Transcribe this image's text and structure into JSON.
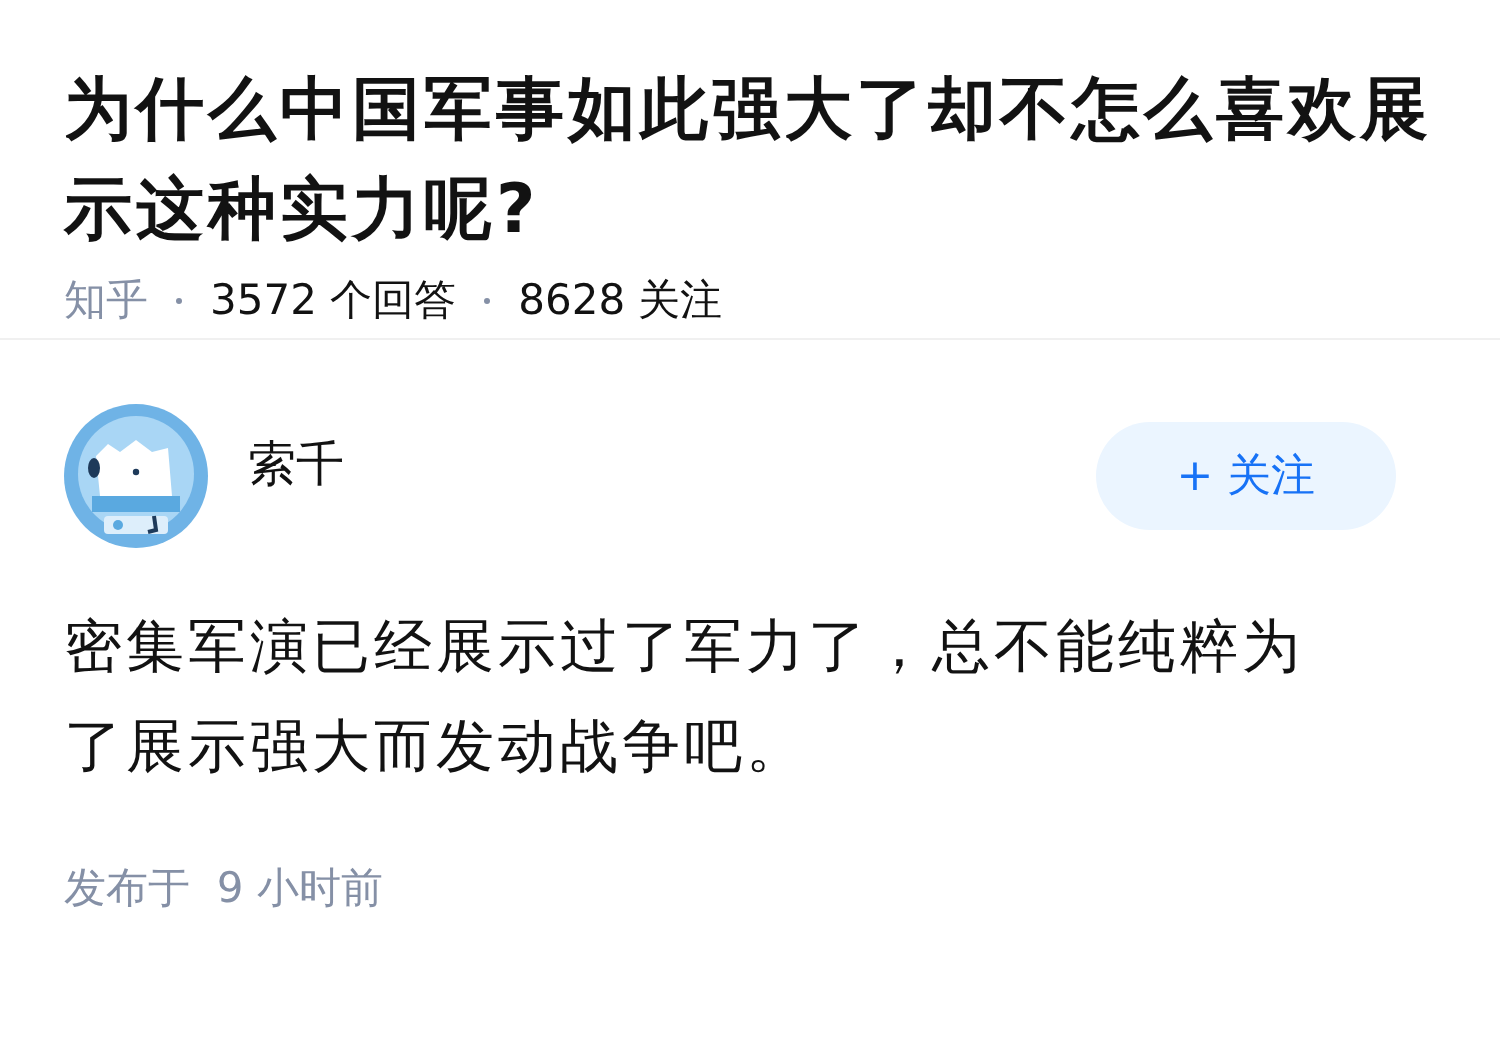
{
  "question": {
    "title": "为什么中国军事如此强大了却不怎么喜欢展示这种实力呢?",
    "meta": [
      "知乎",
      "3572 个回答",
      "8628 关注"
    ]
  },
  "answer": {
    "author": "索千",
    "follow_button": "+ 关注",
    "content": "密集军演已经展示过了军力了，总不能纯粹为了展示强大而发动战争吧。",
    "time": "发布于  9 小时前"
  }
}
